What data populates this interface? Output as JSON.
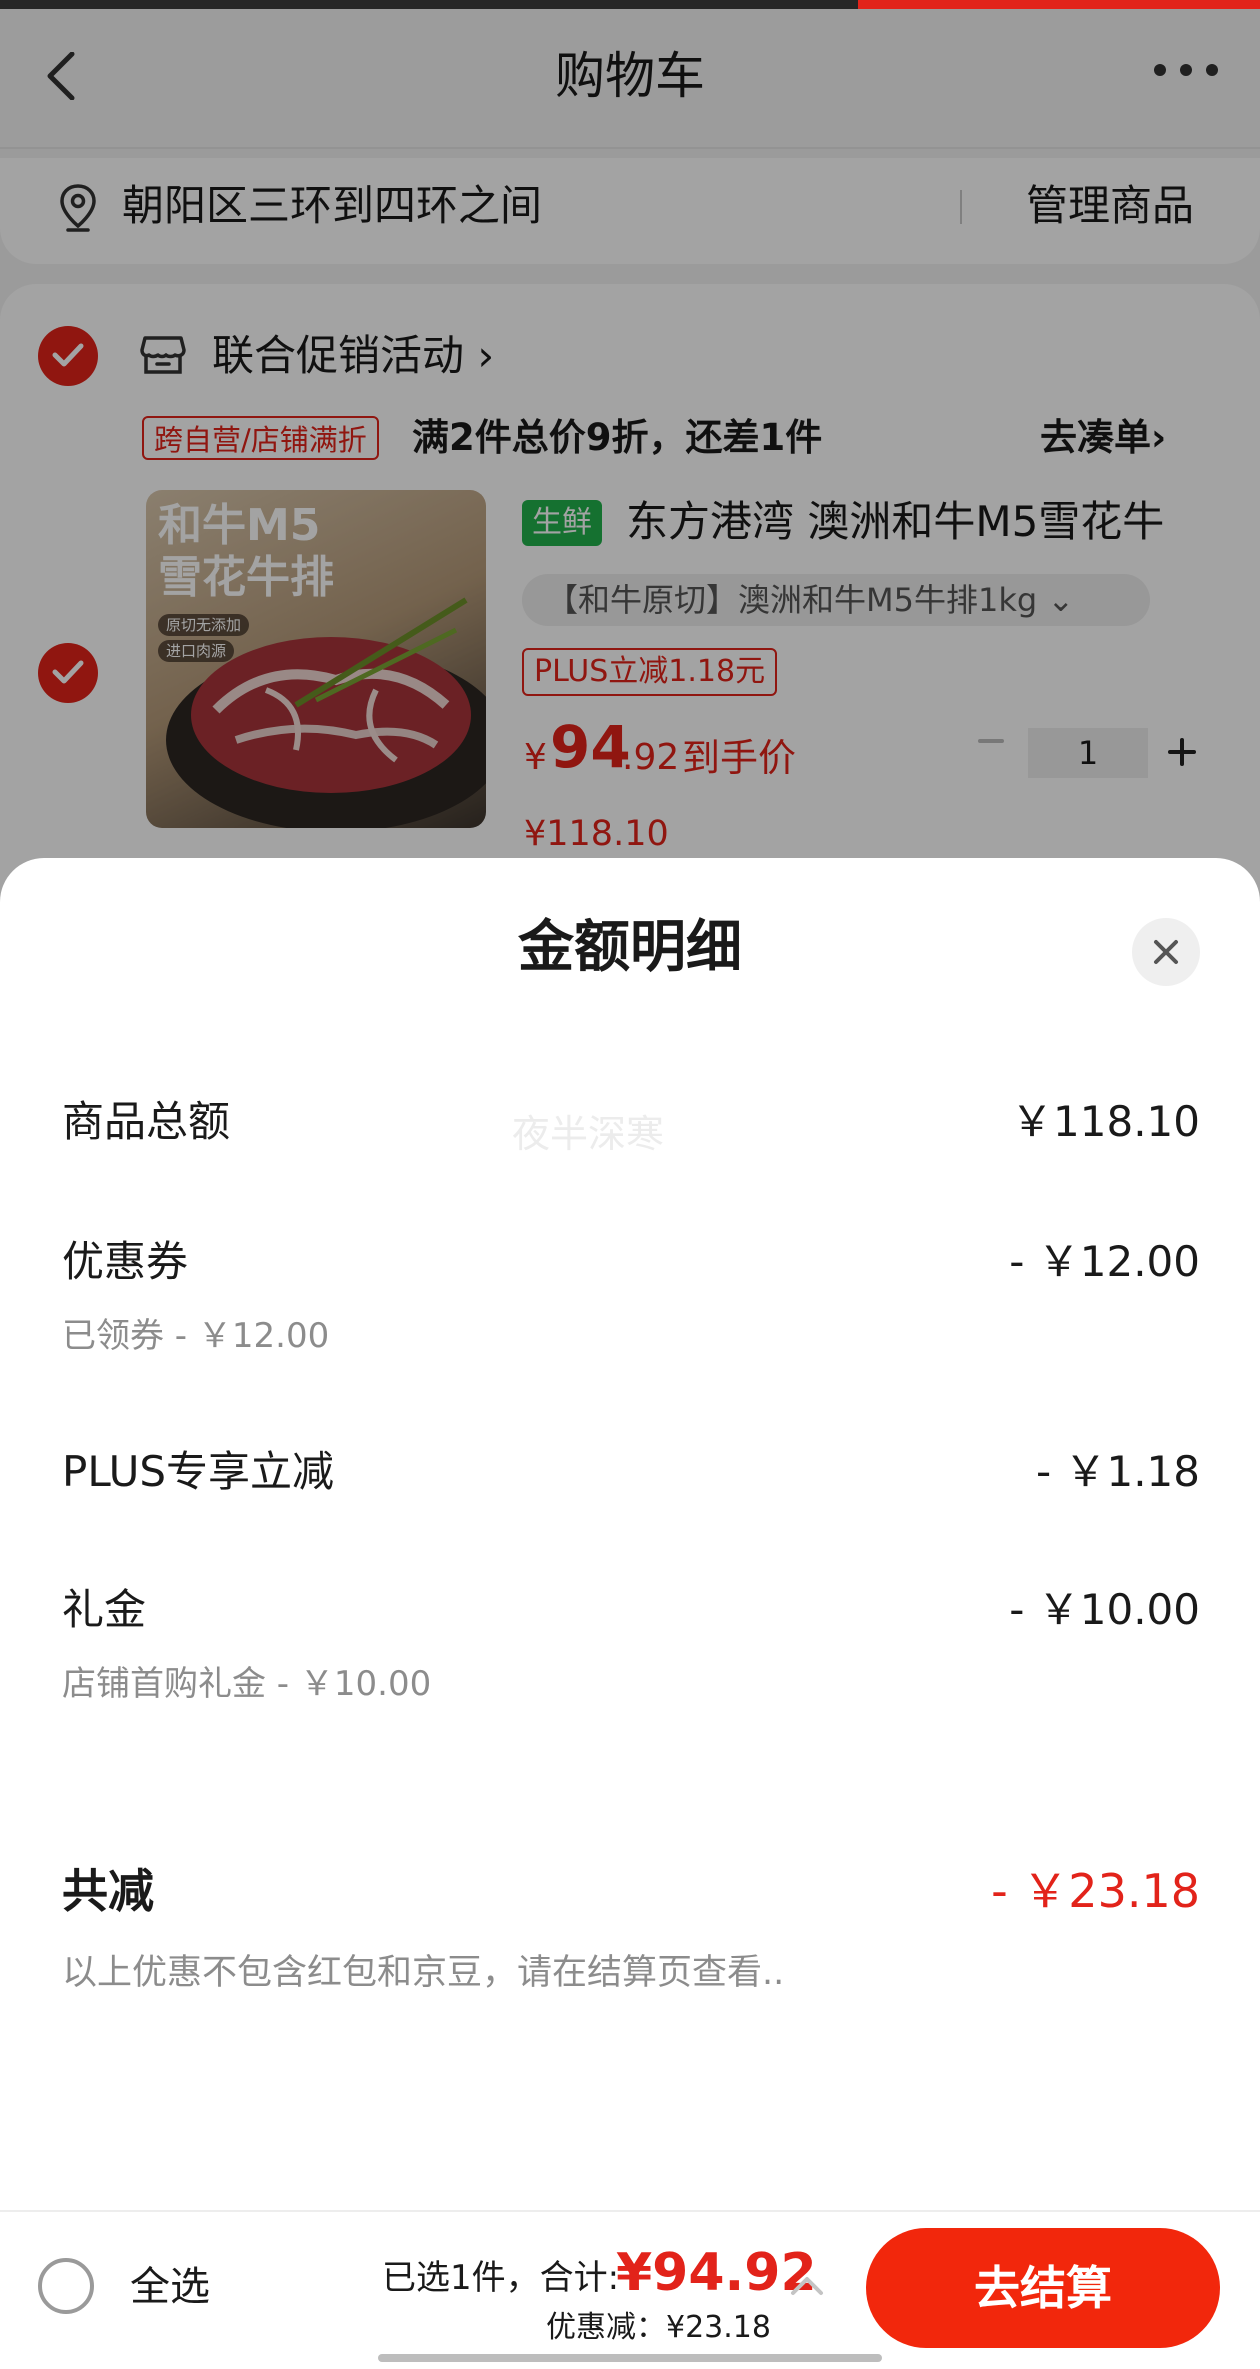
{
  "header": {
    "title": "购物车"
  },
  "address": {
    "text": "朝阳区三环到四环之间",
    "manage_label": "管理商品"
  },
  "promo": {
    "title": "联合促销活动",
    "title_chevron": "›",
    "tag": "跨自营/店铺满折",
    "description": "满2件总价9折，还差1件",
    "link_label": "去凑单›"
  },
  "product": {
    "image_text_line1": "和牛M5",
    "image_text_line2": "雪花牛排",
    "image_badge1": "原切无添加",
    "image_badge2": "进口肉源",
    "fresh_tag": "生鲜",
    "name": "东方港湾 澳洲和牛M5雪花牛",
    "spec": "【和牛原切】澳洲和牛M5牛排1kg ⌄",
    "plus_tag": "PLUS立减1.18元",
    "price_symbol": "¥",
    "price_integer": "94",
    "price_decimal": ".92",
    "price_note": "到手价",
    "quantity": "1",
    "original_price": "¥118.10"
  },
  "sheet": {
    "title": "金额明细",
    "watermark": "夜半深寒",
    "rows": [
      {
        "label": "商品总额",
        "amount": "￥118.10",
        "sub": ""
      },
      {
        "label": "优惠券",
        "amount": "- ￥12.00",
        "sub": "已领券 - ￥12.00"
      },
      {
        "label": "PLUS专享立减",
        "amount": "- ￥1.18",
        "sub": ""
      },
      {
        "label": "礼金",
        "amount": "- ￥10.00",
        "sub": "店铺首购礼金 - ￥10.00"
      }
    ],
    "total_label": "共减",
    "total_amount": "- ￥23.18",
    "total_note": "以上优惠不包含红包和京豆，请在结算页查看.."
  },
  "bottom": {
    "select_all": "全选",
    "selected_text": "已选1件，合计:",
    "total_price": "¥94.92",
    "discount_text": "优惠减：¥23.18",
    "checkout_label": "去结算"
  },
  "colors": {
    "accent": "#e2231a",
    "checkout": "#f2270c",
    "fresh": "#22b14c"
  }
}
